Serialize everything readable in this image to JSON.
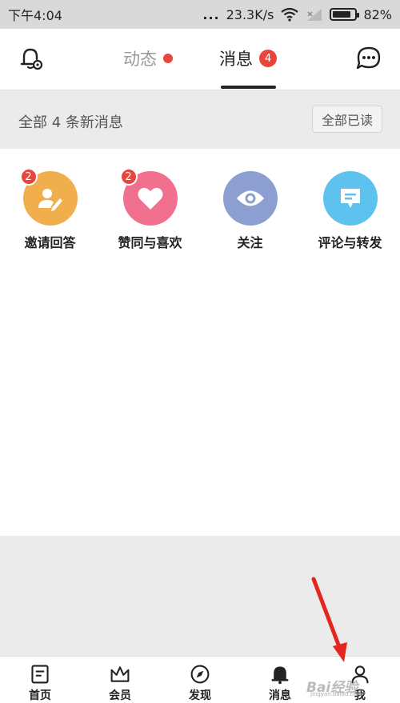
{
  "status_bar": {
    "time": "下午4:04",
    "dots": "...",
    "network_speed": "23.3K/s",
    "battery_percent": "82%",
    "battery_level": 0.82
  },
  "top_nav": {
    "tabs": [
      {
        "label": "动态",
        "has_dot": true
      },
      {
        "label": "消息",
        "badge": "4",
        "active": true
      }
    ]
  },
  "summary": {
    "text": "全部 4 条新消息",
    "mark_all_read": "全部已读"
  },
  "categories": [
    {
      "label": "邀请回答",
      "badge": "2",
      "color": "#f0ae4c",
      "icon": "invite-answer-icon"
    },
    {
      "label": "赞同与喜欢",
      "badge": "2",
      "color": "#f0708d",
      "icon": "heart-icon"
    },
    {
      "label": "关注",
      "badge": "",
      "color": "#8c9fd0",
      "icon": "eye-icon"
    },
    {
      "label": "评论与转发",
      "badge": "",
      "color": "#5ec2ef",
      "icon": "comment-icon"
    }
  ],
  "bottom_nav": [
    {
      "label": "首页",
      "icon": "home-doc-icon"
    },
    {
      "label": "会员",
      "icon": "crown-icon"
    },
    {
      "label": "发现",
      "icon": "compass-icon"
    },
    {
      "label": "消息",
      "icon": "bell-icon"
    },
    {
      "label": "我",
      "icon": "person-icon"
    }
  ],
  "watermark": {
    "text": "Bai经验",
    "sub": "jingyan.baidu.com"
  },
  "colors": {
    "accent_red": "#e8453c",
    "arrow_red": "#e3261f"
  }
}
